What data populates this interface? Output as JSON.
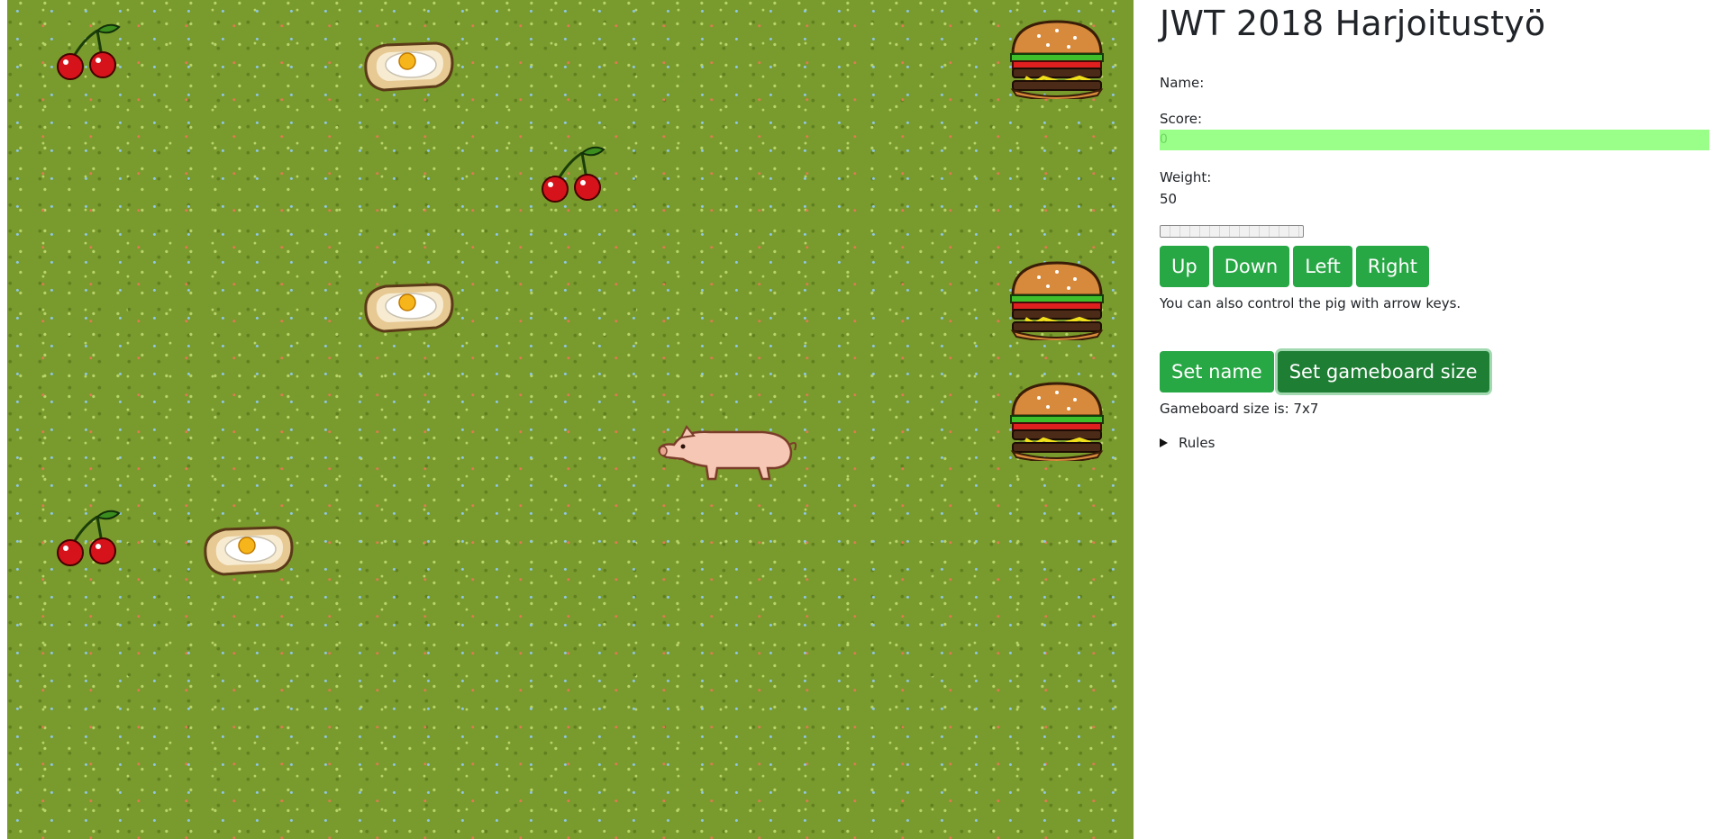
{
  "title": "JWT 2018 Harjoitustyö",
  "name": {
    "label": "Name:",
    "value": ""
  },
  "score": {
    "label": "Score:",
    "value": "0"
  },
  "weight": {
    "label": "Weight:",
    "value": "50"
  },
  "progress": {
    "fraction": 0
  },
  "controls": {
    "up": "Up",
    "down": "Down",
    "left": "Left",
    "right": "Right",
    "hint": "You can also control the pig with arrow keys."
  },
  "settings": {
    "set_name": "Set name",
    "set_gameboard_size": "Set gameboard size",
    "gameboard_size_text": "Gameboard size is: 7x7"
  },
  "rules": {
    "label": "Rules"
  },
  "board": {
    "size": "7x7",
    "items": [
      "cherry",
      "egg-toast",
      "burger",
      "cherry",
      "egg-toast",
      "burger",
      "burger",
      "pig",
      "cherry",
      "egg-toast"
    ]
  },
  "colors": {
    "grass": "#799a2c",
    "button": "#28a745",
    "button_active": "#1e7e34",
    "score_bar": "#99ff88"
  }
}
